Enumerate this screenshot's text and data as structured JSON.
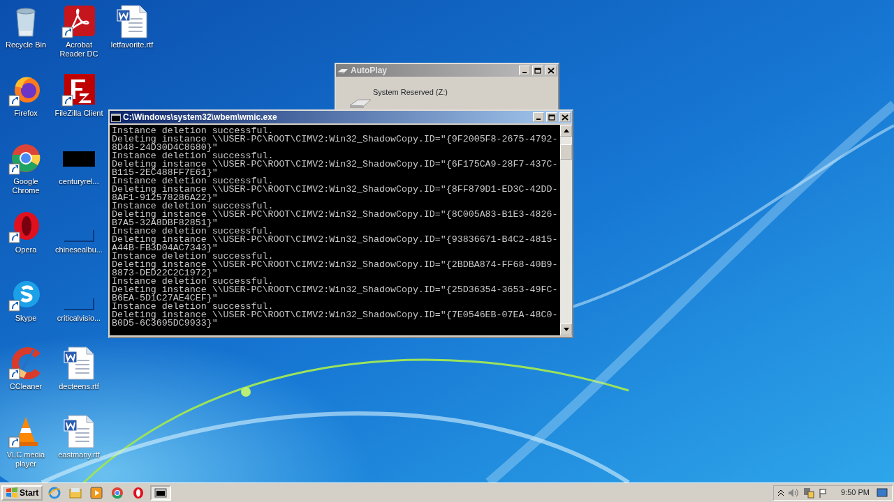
{
  "desktop_icons": [
    {
      "label": "Recycle Bin",
      "kind": "recycle",
      "shortcut": false
    },
    {
      "label": "Firefox",
      "kind": "firefox",
      "shortcut": true
    },
    {
      "label": "Google Chrome",
      "kind": "chrome",
      "shortcut": true
    },
    {
      "label": "Opera",
      "kind": "opera",
      "shortcut": true
    },
    {
      "label": "Skype",
      "kind": "skype",
      "shortcut": true
    },
    {
      "label": "CCleaner",
      "kind": "ccleaner",
      "shortcut": true
    },
    {
      "label": "VLC media player",
      "kind": "vlc",
      "shortcut": true
    },
    {
      "label": "Acrobat Reader DC",
      "kind": "acrobat",
      "shortcut": true
    },
    {
      "label": "FileZilla Client",
      "kind": "filezilla",
      "shortcut": true
    },
    {
      "label": "centuryrel...",
      "kind": "dark",
      "shortcut": false
    },
    {
      "label": "chinesealbu...",
      "kind": "blank",
      "shortcut": false
    },
    {
      "label": "criticalvisio...",
      "kind": "blank",
      "shortcut": false
    },
    {
      "label": "decteens.rtf",
      "kind": "word",
      "shortcut": false
    },
    {
      "label": "eastmany.rtf",
      "kind": "word",
      "shortcut": false
    },
    {
      "label": "letfavorite.rtf",
      "kind": "word",
      "shortcut": false
    }
  ],
  "autoplay_window": {
    "title": "AutoPlay",
    "active": false,
    "drive_label": "System Reserved (Z:)"
  },
  "console_window": {
    "title": "C:\\Windows\\system32\\wbem\\wmic.exe",
    "active": true,
    "lines": [
      "Instance deletion successful.",
      "Deleting instance \\\\USER-PC\\ROOT\\CIMV2:Win32_ShadowCopy.ID=\"{9F2005F8-2675-4792-",
      "8D48-24D30D4C8680}\"",
      "Instance deletion successful.",
      "Deleting instance \\\\USER-PC\\ROOT\\CIMV2:Win32_ShadowCopy.ID=\"{6F175CA9-28F7-437C-",
      "B115-2EC488FF7E61}\"",
      "Instance deletion successful.",
      "Deleting instance \\\\USER-PC\\ROOT\\CIMV2:Win32_ShadowCopy.ID=\"{8FF879D1-ED3C-42DD-",
      "8AF1-912578286A22}\"",
      "Instance deletion successful.",
      "Deleting instance \\\\USER-PC\\ROOT\\CIMV2:Win32_ShadowCopy.ID=\"{8C005A83-B1E3-4826-",
      "B7A5-32A8DBF82851}\"",
      "Instance deletion successful.",
      "Deleting instance \\\\USER-PC\\ROOT\\CIMV2:Win32_ShadowCopy.ID=\"{93836671-B4C2-4815-",
      "A44B-FB3D04AC7343}\"",
      "Instance deletion successful.",
      "Deleting instance \\\\USER-PC\\ROOT\\CIMV2:Win32_ShadowCopy.ID=\"{2BDBA874-FF68-40B9-",
      "8873-DED22C2C1972}\"",
      "Instance deletion successful.",
      "Deleting instance \\\\USER-PC\\ROOT\\CIMV2:Win32_ShadowCopy.ID=\"{25D36354-3653-49FC-",
      "B6EA-5D1C27AE4CEF}\"",
      "Instance deletion successful.",
      "Deleting instance \\\\USER-PC\\ROOT\\CIMV2:Win32_ShadowCopy.ID=\"{7E0546EB-07EA-48C0-",
      "B0D5-6C3695DC9933}\""
    ]
  },
  "taskbar": {
    "start_label": "Start",
    "items": [
      {
        "kind": "ie",
        "active": false
      },
      {
        "kind": "folder",
        "active": false
      },
      {
        "kind": "media",
        "active": false
      },
      {
        "kind": "chrome",
        "active": false
      },
      {
        "kind": "opera",
        "active": false
      },
      {
        "kind": "console",
        "active": true
      }
    ],
    "clock": "9:50 PM"
  }
}
